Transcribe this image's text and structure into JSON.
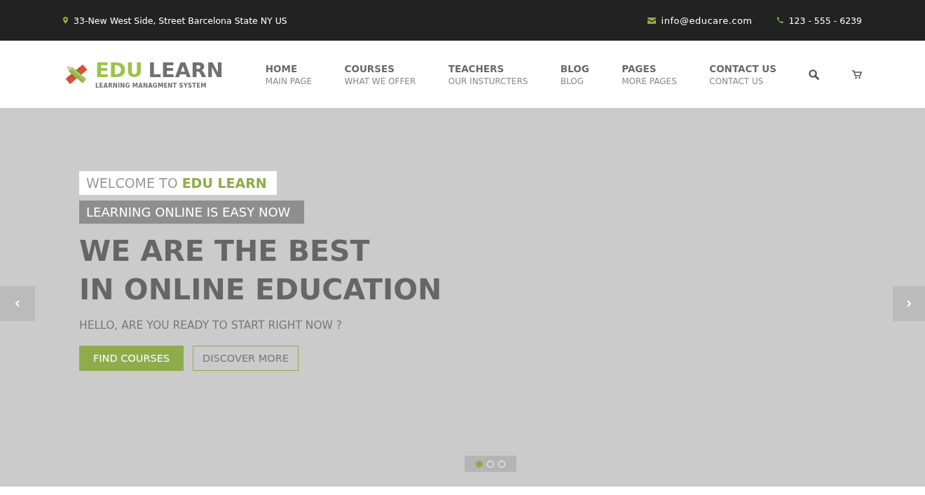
{
  "top_bar": {
    "address": "33-New West Side, Street Barcelona State NY US",
    "email": "info@educare.com",
    "phone": "123 - 555 - 6239"
  },
  "logo": {
    "brand_primary": "EDU",
    "brand_secondary": "LEARN",
    "tagline": "LEARNING MANAGMENT SYSTEM"
  },
  "nav": [
    {
      "title": "HOME",
      "subtitle": "MAIN PAGE"
    },
    {
      "title": "COURSES",
      "subtitle": "WHAT WE OFFER"
    },
    {
      "title": "TEACHERS",
      "subtitle": "OUR INSTURCTERS"
    },
    {
      "title": "BLOG",
      "subtitle": "BLOG"
    },
    {
      "title": "PAGES",
      "subtitle": "MORE PAGES"
    },
    {
      "title": "CONTACT US",
      "subtitle": "CONTACT US"
    }
  ],
  "hero": {
    "tag_primary": "WELCOME TO **EDU LEARN**",
    "tag_secondary": "LEARNING ONLINE IS EASY NOW",
    "headline_lines": [
      "WE ARE THE BEST",
      "IN ONLINE EDUCATION"
    ],
    "subtitle": "HELLO, ARE YOU READY TO START RIGHT NOW ?",
    "buttons": [
      {
        "label": "FIND COURSES",
        "kind": "primary"
      },
      {
        "label": "DISCOVER MORE",
        "kind": "outline"
      }
    ]
  },
  "slider_dots": [
    {
      "selected": true
    },
    {
      "selected": false
    },
    {
      "selected": false
    }
  ]
}
